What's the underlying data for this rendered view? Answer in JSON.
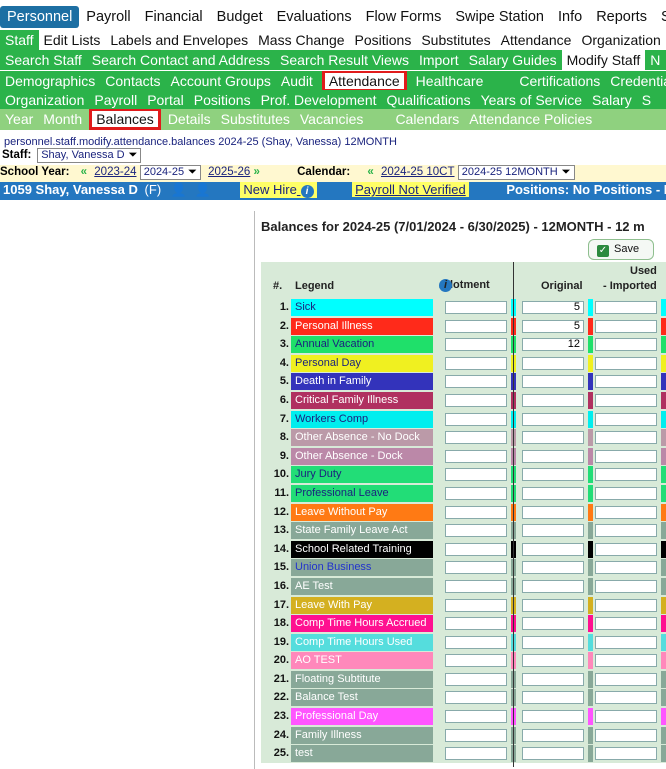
{
  "top_nav": [
    "Personnel",
    "Payroll",
    "Financial",
    "Budget",
    "Evaluations",
    "Flow Forms",
    "Swipe Station",
    "Info",
    "Reports",
    "Sys"
  ],
  "sub_nav": [
    "Staff",
    "Edit Lists",
    "Labels and Envelopes",
    "Mass Change",
    "Positions",
    "Substitutes",
    "Attendance",
    "Organization"
  ],
  "staff_nav": [
    "Search Staff",
    "Search Contact and Address",
    "Search Result Views",
    "Import",
    "Salary Guides",
    "Modify Staff",
    "N"
  ],
  "staff_tabs_1": [
    "Demographics",
    "Contacts",
    "Account Groups",
    "Audit",
    "Attendance",
    "Healthcare",
    "Certifications",
    "Credential"
  ],
  "staff_tabs_2": [
    "Organization",
    "Payroll",
    "Portal",
    "Positions",
    "Prof. Development",
    "Qualifications",
    "Years of Service",
    "Salary",
    "S"
  ],
  "attendance_tabs": [
    "Year",
    "Month",
    "Balances",
    "Details",
    "Substitutes",
    "Vacancies",
    "Calendars",
    "Attendance Policies"
  ],
  "breadcrumb": "personnel.staff.modify.attendance.balances 2024-25 (Shay, Vanessa) 12MONTH",
  "staff": {
    "label": "Staff:",
    "value": "Shay, Vanessa D"
  },
  "school_year": {
    "label": "School Year:",
    "prev": "2023-24",
    "value": "2024-25",
    "next": "2025-26"
  },
  "calendar": {
    "label": "Calendar:",
    "prev": "2024-25 10CT",
    "value": "2024-25 12MONTH"
  },
  "info_bar": {
    "employee": "1059 Shay, Vanessa D",
    "gender": "(F)",
    "new_hire": "New Hire",
    "payroll": "Payroll Not Verified",
    "positions_label": "Positions:",
    "positions_value": "No Positions - NT"
  },
  "panel": {
    "title": "Balances for 2024-25 (7/01/2024 - 6/30/2025) - 12MONTH - 12 m",
    "save": "Save",
    "headers": {
      "num": "#.",
      "legend": "Legend",
      "allotment": "Allotment",
      "original": "Original",
      "used": "Used",
      "imported": "- Imported"
    }
  },
  "rows": [
    {
      "n": "1.",
      "label": "Sick",
      "bg": "#00ffff",
      "fg": "#1a237e",
      "orig": "5"
    },
    {
      "n": "2.",
      "label": "Personal Illness",
      "bg": "#ff2a1a",
      "fg": "#ffffff",
      "orig": "5"
    },
    {
      "n": "3.",
      "label": "Annual Vacation",
      "bg": "#1fe06a",
      "fg": "#1a237e",
      "orig": "12"
    },
    {
      "n": "4.",
      "label": "Personal Day",
      "bg": "#f0f020",
      "fg": "#1a237e",
      "orig": ""
    },
    {
      "n": "5.",
      "label": "Death in Family",
      "bg": "#3333bb",
      "fg": "#ffffff",
      "orig": ""
    },
    {
      "n": "6.",
      "label": "Critical Family Illness",
      "bg": "#b03060",
      "fg": "#ffffff",
      "orig": ""
    },
    {
      "n": "7.",
      "label": "Workers Comp",
      "bg": "#00eeee",
      "fg": "#1a237e",
      "orig": ""
    },
    {
      "n": "8.",
      "label": "Other Absence - No Dock",
      "bg": "#bb9aa8",
      "fg": "#ffffff",
      "orig": ""
    },
    {
      "n": "9.",
      "label": "Other Absence - Dock",
      "bg": "#bb88a8",
      "fg": "#ffffff",
      "orig": ""
    },
    {
      "n": "10.",
      "label": "Jury Duty",
      "bg": "#22dd77",
      "fg": "#1a237e",
      "orig": ""
    },
    {
      "n": "11.",
      "label": "Professional Leave",
      "bg": "#22dd77",
      "fg": "#1a237e",
      "orig": ""
    },
    {
      "n": "12.",
      "label": "Leave Without Pay",
      "bg": "#ff7a14",
      "fg": "#ffffff",
      "orig": ""
    },
    {
      "n": "13.",
      "label": "State Family Leave Act",
      "bg": "#88a898",
      "fg": "#ffffff",
      "orig": ""
    },
    {
      "n": "14.",
      "label": "School Related Training",
      "bg": "#000000",
      "fg": "#ffffff",
      "orig": ""
    },
    {
      "n": "15.",
      "label": "Union Business",
      "bg": "#88a898",
      "fg": "#2233cc",
      "orig": ""
    },
    {
      "n": "16.",
      "label": "AE Test",
      "bg": "#88a898",
      "fg": "#ffffff",
      "orig": ""
    },
    {
      "n": "17.",
      "label": "Leave With Pay",
      "bg": "#d4b020",
      "fg": "#ffffff",
      "orig": ""
    },
    {
      "n": "18.",
      "label": "Comp Time Hours Accrued",
      "bg": "#ff1090",
      "fg": "#ffffff",
      "orig": ""
    },
    {
      "n": "19.",
      "label": "Comp Time Hours Used",
      "bg": "#55dddd",
      "fg": "#ffffff",
      "orig": ""
    },
    {
      "n": "20.",
      "label": "AO TEST",
      "bg": "#ff88bb",
      "fg": "#ffffff",
      "orig": ""
    },
    {
      "n": "21.",
      "label": "Floating Subtitute",
      "bg": "#88a898",
      "fg": "#ffffff",
      "orig": ""
    },
    {
      "n": "22.",
      "label": "Balance Test",
      "bg": "#88a898",
      "fg": "#ffffff",
      "orig": ""
    },
    {
      "n": "23.",
      "label": "Professional Day",
      "bg": "#ff55ff",
      "fg": "#ffffff",
      "orig": ""
    },
    {
      "n": "24.",
      "label": "Family Illness",
      "bg": "#88a898",
      "fg": "#ffffff",
      "orig": ""
    },
    {
      "n": "25.",
      "label": "test",
      "bg": "#88a898",
      "fg": "#ffffff",
      "orig": ""
    }
  ]
}
